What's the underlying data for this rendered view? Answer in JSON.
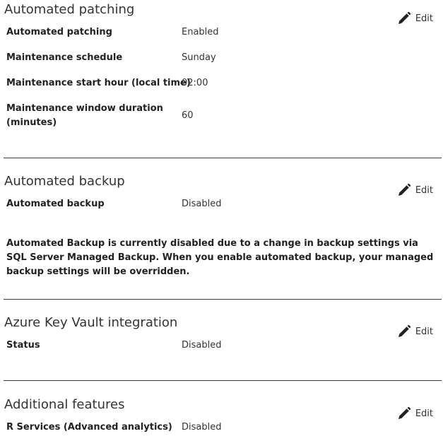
{
  "edit_label": "Edit",
  "icons": {
    "edit": "pencil-icon"
  },
  "patching": {
    "title": "Automated patching",
    "rows": [
      {
        "label": "Automated patching",
        "value": "Enabled"
      },
      {
        "label": "Maintenance schedule",
        "value": "Sunday"
      },
      {
        "label": "Maintenance start hour (local time)",
        "value": "02:00"
      },
      {
        "label": "Maintenance window duration (minutes)",
        "value": "60"
      }
    ]
  },
  "backup": {
    "title": "Automated backup",
    "rows": [
      {
        "label": "Automated backup",
        "value": "Disabled"
      }
    ],
    "note": "Automated Backup is currently disabled due to a change in backup settings via SQL Server Managed Backup. When you enable automated backup, your managed backup settings will be overridden."
  },
  "keyvault": {
    "title": "Azure Key Vault integration",
    "rows": [
      {
        "label": "Status",
        "value": "Disabled"
      }
    ]
  },
  "additional": {
    "title": "Additional features",
    "rows": [
      {
        "label": "R Services (Advanced analytics)",
        "value": "Disabled"
      }
    ]
  }
}
